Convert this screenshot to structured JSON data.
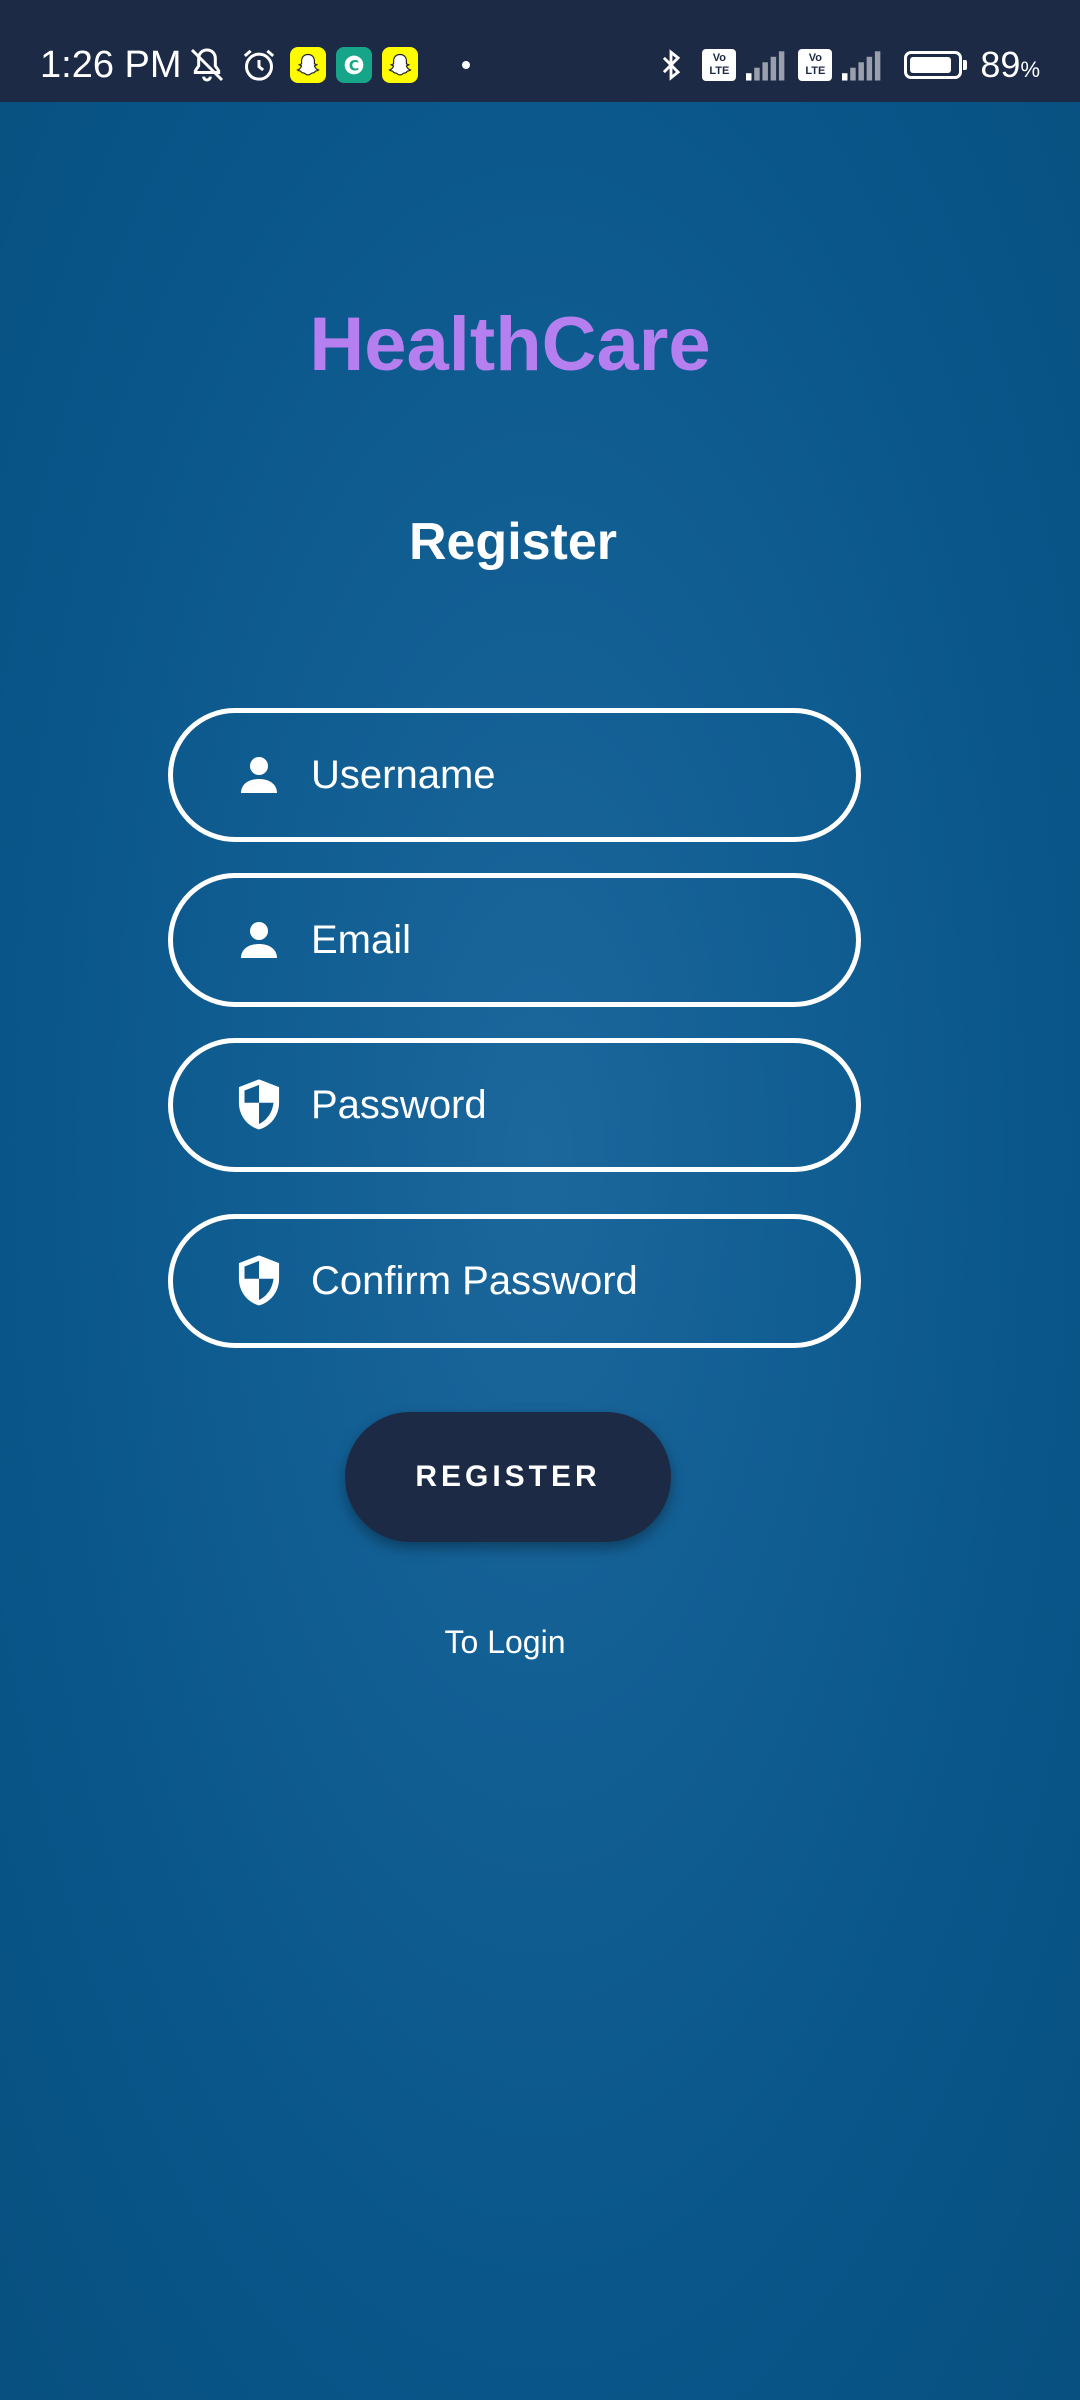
{
  "status_bar": {
    "time": "1:26 PM",
    "left_icons": [
      "bell-off-icon",
      "alarm-icon",
      "snapchat-icon",
      "app-green-icon",
      "snapchat-icon"
    ],
    "sim1_label": "Vo LTE",
    "sim2_label": "Vo LTE",
    "battery_percent": "89",
    "battery_unit": "%",
    "battery_level": 0.89
  },
  "app": {
    "title": "HealthCare",
    "title_color": "#b57ff0"
  },
  "form": {
    "heading": "Register",
    "username_placeholder": "Username",
    "email_placeholder": "Email",
    "password_placeholder": "Password",
    "confirm_password_placeholder": "Confirm Password",
    "register_label": "REGISTER",
    "to_login_label": "To Login"
  },
  "colors": {
    "background": "#0d5a8e",
    "status_bar": "#1d2a45",
    "button": "#1d2a45",
    "accent": "#b57ff0"
  }
}
